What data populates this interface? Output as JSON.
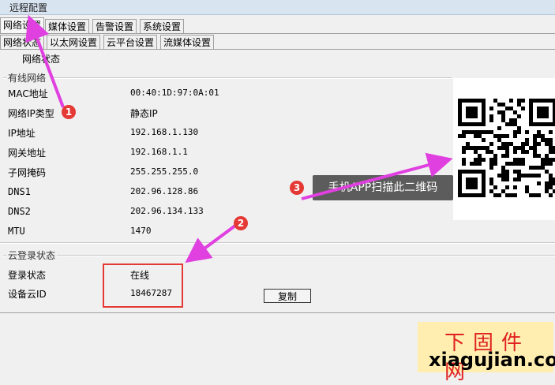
{
  "window": {
    "title": "远程配置"
  },
  "tabs_top": [
    {
      "label": "网络设置",
      "active": true
    },
    {
      "label": "媒体设置"
    },
    {
      "label": "告警设置"
    },
    {
      "label": "系统设置"
    }
  ],
  "tabs_sub": [
    {
      "label": "网络状态",
      "active": true
    },
    {
      "label": "以太网设置"
    },
    {
      "label": "云平台设置"
    },
    {
      "label": "流媒体设置"
    }
  ],
  "sub_title": "网络状态",
  "wired": {
    "group_title": "有线网络",
    "rows": [
      {
        "label": "MAC地址",
        "value": "00:40:1D:97:0A:01"
      },
      {
        "label": "网络IP类型",
        "value": "静态IP"
      },
      {
        "label": "IP地址",
        "value": "192.168.1.130"
      },
      {
        "label": "网关地址",
        "value": "192.168.1.1"
      },
      {
        "label": "子网掩码",
        "value": "255.255.255.0"
      },
      {
        "label": "DNS1",
        "value": "202.96.128.86"
      },
      {
        "label": "DNS2",
        "value": "202.96.134.133"
      },
      {
        "label": "MTU",
        "value": "1470"
      }
    ]
  },
  "cloud": {
    "group_title": "云登录状态",
    "login_label": "登录状态",
    "login_value": "在线",
    "id_label": "设备云ID",
    "id_value": "18467287",
    "copy_label": "复制"
  },
  "annotations": {
    "tooltip": "手机APP扫描此二维码",
    "badge1": "1",
    "badge2": "2",
    "badge3": "3",
    "accent_color": "#e040e0",
    "badge_color": "#e53935"
  },
  "watermark": {
    "line1": "下固件网",
    "line2": "xiagujian.com"
  }
}
